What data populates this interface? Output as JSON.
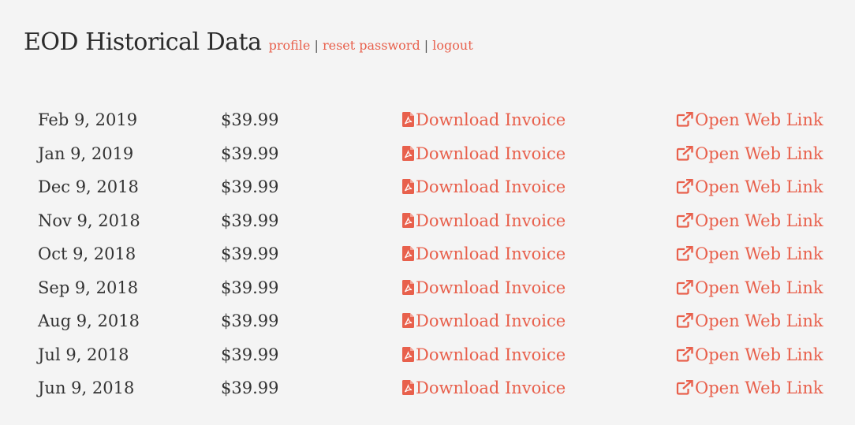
{
  "header": {
    "title": "EOD Historical Data",
    "nav": {
      "profile": "profile",
      "separator": "|",
      "reset_password": "reset password",
      "logout": "logout"
    }
  },
  "colors": {
    "link": "#e8604c",
    "background": "#f4f4f4",
    "text": "#333333"
  },
  "invoices": [
    {
      "date": "Feb 9, 2019",
      "amount": "$39.99",
      "download_label": "Download Invoice",
      "web_label": "Open Web Link"
    },
    {
      "date": "Jan 9, 2019",
      "amount": "$39.99",
      "download_label": "Download Invoice",
      "web_label": "Open Web Link"
    },
    {
      "date": "Dec 9, 2018",
      "amount": "$39.99",
      "download_label": "Download Invoice",
      "web_label": "Open Web Link"
    },
    {
      "date": "Nov 9, 2018",
      "amount": "$39.99",
      "download_label": "Download Invoice",
      "web_label": "Open Web Link"
    },
    {
      "date": "Oct 9, 2018",
      "amount": "$39.99",
      "download_label": "Download Invoice",
      "web_label": "Open Web Link"
    },
    {
      "date": "Sep 9, 2018",
      "amount": "$39.99",
      "download_label": "Download Invoice",
      "web_label": "Open Web Link"
    },
    {
      "date": "Aug 9, 2018",
      "amount": "$39.99",
      "download_label": "Download Invoice",
      "web_label": "Open Web Link"
    },
    {
      "date": "Jul 9, 2018",
      "amount": "$39.99",
      "download_label": "Download Invoice",
      "web_label": "Open Web Link"
    },
    {
      "date": "Jun 9, 2018",
      "amount": "$39.99",
      "download_label": "Download Invoice",
      "web_label": "Open Web Link"
    }
  ],
  "icons": {
    "download": "file-pdf-icon",
    "web": "external-link-icon"
  }
}
